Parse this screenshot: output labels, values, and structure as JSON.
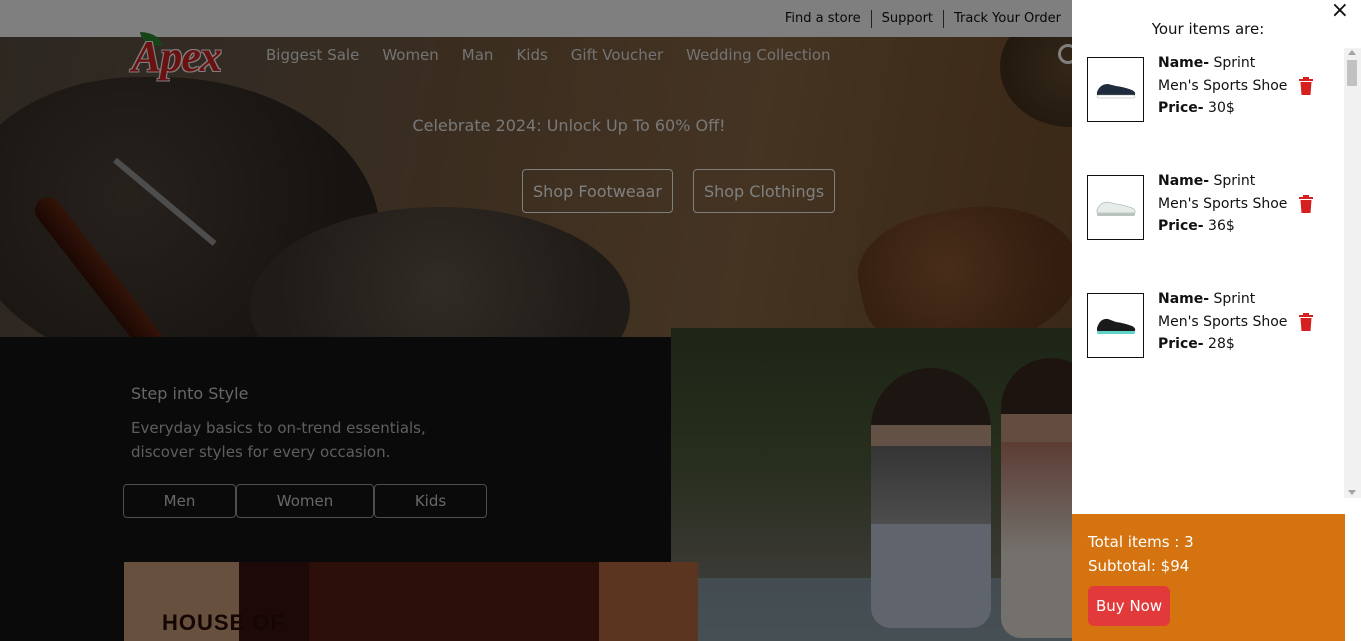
{
  "topbar": {
    "links": [
      "Find a store",
      "Support",
      "Track Your Order"
    ]
  },
  "brand": {
    "logo_text": "Apex",
    "accent": "#d42424"
  },
  "nav": {
    "items": [
      "Biggest Sale",
      "Women",
      "Man",
      "Kids",
      "Gift Voucher",
      "Wedding Collection"
    ]
  },
  "hero": {
    "promo": "Celebrate 2024: Unlock Up To 60% Off!",
    "buttons": [
      "Shop Footweaar",
      "Shop Clothings"
    ]
  },
  "style_section": {
    "title": "Step into Style",
    "description": "Everyday basics to on-trend essentials, discover styles for every occasion.",
    "categories": [
      "Men",
      "Women",
      "Kids"
    ]
  },
  "house_banner": {
    "text": "HOUSE OF"
  },
  "cart": {
    "close_label": "×",
    "title": "Your items are:",
    "name_label": "Name-",
    "price_label": "Price-",
    "items": [
      {
        "name": "Sprint Men's Sports Shoe",
        "price": "30$",
        "shoe_color": "#1f2c3d",
        "sole_color": "#ffffff"
      },
      {
        "name": "Sprint Men's Sports Shoe",
        "price": "36$",
        "shoe_color": "#e6ece8",
        "sole_color": "#b8c4bc"
      },
      {
        "name": "Sprint Men's Sports Shoe",
        "price": "28$",
        "shoe_color": "#1a1a1a",
        "sole_color": "#5fd3c8"
      }
    ],
    "total_items": "Total items : 3",
    "subtotal": "Subtotal: $94",
    "buy_label": "Buy Now",
    "footer_color": "#d4730f",
    "buy_color": "#e23a3a",
    "trash_color": "#d61f1f"
  }
}
